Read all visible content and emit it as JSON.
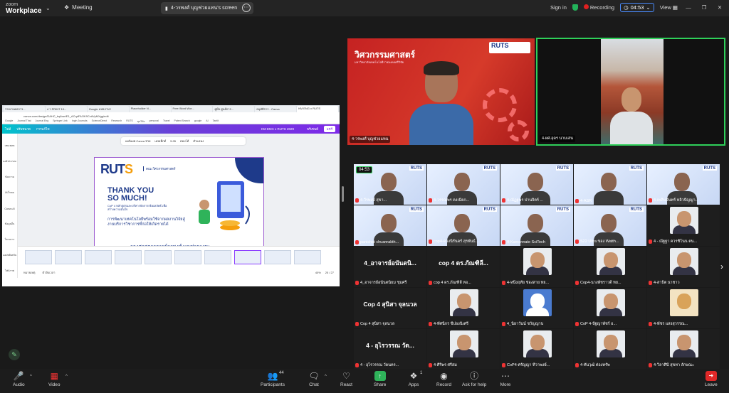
{
  "app": {
    "brand_top": "zoom",
    "brand_bottom": "Workplace"
  },
  "titlebar": {
    "meeting_label": "Meeting",
    "share_tab_label": "4-วรพงศ์ บุญช่วยแทน's screen",
    "sign_in": "Sign in",
    "recording_label": "Recording",
    "timer": "04:53",
    "view_label": "View"
  },
  "shared_screen": {
    "browser_tabs": [
      "รายงานผลการ...",
      "4 ว PRINT 10...",
      "Google แปลภาษา",
      "Placeholder N...",
      "Free Word Wor...",
      "คู่มือ ศูนย์การ...",
      "อนุมัติการ - Canva",
      "KM ENG x RUTS"
    ],
    "address": "canva.com/design/DAHC_bq6ow/E1_ACqdFAOK9CzAVyMXgg/edit",
    "bookmarks": [
      "Google",
      "Journal Thai",
      "Journal Eng",
      "Springer Link",
      "Ingin Journals",
      "ScienceDirect",
      "Research",
      "RUTS",
      "ทุนวิจัย",
      "personal",
      "Travel",
      "Patent Search",
      "google",
      "AI",
      "Tantit"
    ],
    "canva_menu": [
      "ไฟล์",
      "ปรับขนาด",
      "การแก้ไข"
    ],
    "canva_title": "KM ENG x RUTS 2029",
    "canva_share": "แชร์",
    "canva_present": "พรีเซนต์",
    "toolbar_items": [
      "แอนิเมต Canva ช่วย",
      "เอฟเฟ็กต์",
      "5.05",
      "ตอบโต้",
      "ตำแหน่ง"
    ],
    "left_panel": [
      "เทมเพลต",
      "องค์ประกอบ",
      "ข้อความ",
      "อัปโหลด",
      "Canva AI",
      "ข้อมูลอื่น",
      "โครงการ",
      "แอปพลิเคชัน",
      "ไฟล์ภาพ"
    ],
    "slide": {
      "logo_main": "RUT",
      "logo_accent": "S",
      "faculty": "คณะวิศวกรรมศาสตร์",
      "thank_line1": "THANK YOU",
      "thank_line2": "SO MUCH!",
      "cop_text": "CoP 4 หลักสูตรและบริหารจัดการเชิงผลลัพธ์ เพื่อสร้างความมั่นใจ",
      "desc": "การพัฒนาเทคโนโลยีพร้อมใช้จากผลงานวิจัยสู่งานบริการวิชาการที่ก่อให้เกิดรายได้",
      "presenter": "รองศาสตราจารย์วรพงศ์ บุญช่วยแทน"
    },
    "status_left": [
      "หมายเหตุ",
      "ตัวจับเวลา"
    ],
    "zoom_pct": "40%",
    "page_count": "25 / 27"
  },
  "gallery": {
    "speaker_name": "4-วรพงศ์ บุญช่วยแทน",
    "speaker_banner_title": "วิศวกรรมศาสตร์",
    "speaker_banner_sub": "มหาวิทยาลัยเทคโนโลยีราชมงคลศรีวิชัย",
    "speaker_banner_logo": "RUTS",
    "tile2_name": "4-ผศ.อุดร นามเสน",
    "timer_badge": "04:53",
    "cells": [
      {
        "type": "vid",
        "name": "4-วีรพงษ์ สุขา...",
        "badge": true
      },
      {
        "type": "vid",
        "name": "4-วรรณพร คงเนียก..."
      },
      {
        "type": "vid",
        "name": "4-ณัฏฐพร ปานจิตร์ ..."
      },
      {
        "type": "vid",
        "name": "4-ASR"
      },
      {
        "type": "vid",
        "name": "4-เพลินจันทร์ หลิวปัญญา..."
      },
      {
        "type": "vid",
        "name": "panichat chuanrakth..."
      },
      {
        "type": "vid",
        "name": "cop4-ดวงนิรันดร์ สุรพันธ์..."
      },
      {
        "type": "vid",
        "name": "4-Kamonnate SciTech"
      },
      {
        "type": "vid",
        "name": "S22 Ultra ของ Watth..."
      },
      {
        "type": "photo",
        "name": "4 - ณัฐฐา ควรชิโนน ตน..."
      },
      {
        "type": "text",
        "big": "4_อาจารย์อนันตนิ...",
        "name": "4_อาจารย์อนันตนิยม ชุมศรี"
      },
      {
        "type": "text",
        "big": "cop 4 ดร.ภัณฑิลี...",
        "name": "cop 4 ดร.ภัณฑิลี หอ..."
      },
      {
        "type": "photo",
        "name": "4-หนึ่งฤทัย ช่องสาย ทย..."
      },
      {
        "type": "photo",
        "name": "Cop4-นางพัชราวดี ทย..."
      },
      {
        "type": "photo",
        "name": "4-สาธิต นาชาว"
      },
      {
        "type": "text",
        "big": "Cop 4 สุนิสา จุลนวล",
        "name": "Cop 4 สุนิสา จุลนวล"
      },
      {
        "type": "photo",
        "name": "4-ทัศนีกร ขี่ปองนิเศรี"
      },
      {
        "type": "avatar",
        "name": "4_นิยาวันน์ ชวัญญาน"
      },
      {
        "type": "photo",
        "name": "CoP 4-ปัฐญาพัชร์ อ..."
      },
      {
        "type": "art",
        "name": "4-พัชร แสงสุวรรณ..."
      },
      {
        "type": "text",
        "big": "4 - อุไรวรรณ วัด...",
        "name": "4 - อุไรวรรณ วัดนคร..."
      },
      {
        "type": "photo",
        "name": "4-ศิริพร ศรีสม"
      },
      {
        "type": "photo",
        "name": "CoP4-ศรัญญา ทีวาพงษ์..."
      },
      {
        "type": "photo",
        "name": "4-ทันวุฒิ ต่องทรัพ"
      },
      {
        "type": "photo",
        "name": "4-วิลาศินี สุขทา ลักษณะ"
      }
    ]
  },
  "bottombar": {
    "audio": "Audio",
    "video": "Video",
    "participants": "Participants",
    "participants_count": "44",
    "chat": "Chat",
    "react": "React",
    "share": "Share",
    "apps": "Apps",
    "apps_count": "1",
    "record": "Record",
    "ask_for_help": "Ask for help",
    "more": "More",
    "leave": "Leave"
  },
  "colors": {
    "accent_green": "#2fd05a",
    "rec_red": "#e02020",
    "canva_purple": "#7d2ae8",
    "ruts_blue": "#1e3a8a"
  }
}
